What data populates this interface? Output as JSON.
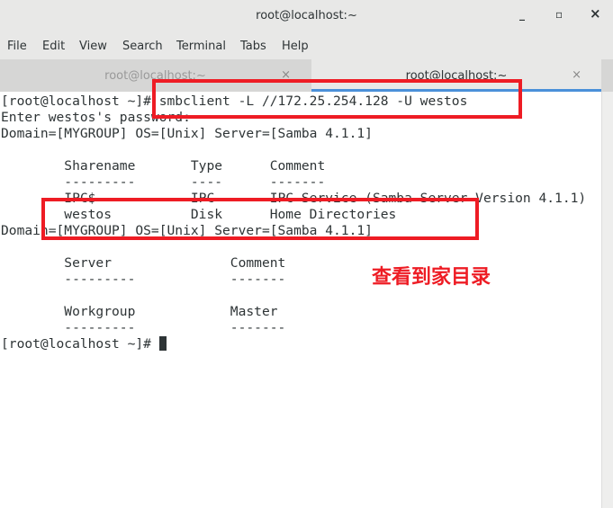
{
  "window": {
    "title": "root@localhost:~",
    "minimize": "_",
    "maximize": "▫",
    "close": "×"
  },
  "menu": [
    "File",
    "Edit",
    "View",
    "Search",
    "Terminal",
    "Tabs",
    "Help"
  ],
  "tabs": [
    {
      "label": "root@localhost:~",
      "close": "×"
    },
    {
      "label": "root@localhost:~",
      "close": "×"
    }
  ],
  "terminal": {
    "lines": [
      "[root@localhost ~]# smbclient -L //172.25.254.128 -U westos",
      "Enter westos's password: ",
      "Domain=[MYGROUP] OS=[Unix] Server=[Samba 4.1.1]",
      "",
      "        Sharename       Type      Comment",
      "        ---------       ----      -------",
      "        IPC$            IPC       IPC Service (Samba Server Version 4.1.1)",
      "        westos          Disk      Home Directories",
      "Domain=[MYGROUP] OS=[Unix] Server=[Samba 4.1.1]",
      "",
      "        Server               Comment",
      "        ---------            -------",
      "",
      "        Workgroup            Master",
      "        ---------            -------"
    ],
    "prompt": "[root@localhost ~]# "
  },
  "annotation": {
    "text": "查看到家目录",
    "color": "#ee1c24"
  }
}
